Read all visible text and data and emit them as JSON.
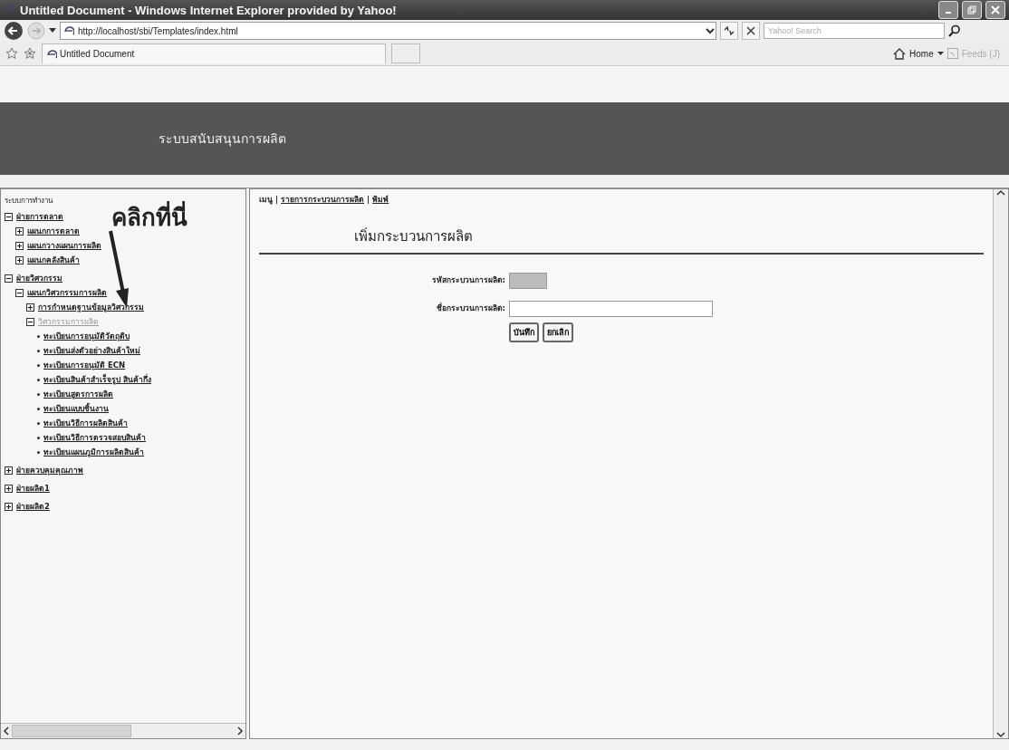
{
  "window": {
    "title": "Untitled Document - Windows Internet Explorer provided by Yahoo!"
  },
  "address_bar": {
    "url": "http://localhost/sbi/Templates/index.html"
  },
  "search": {
    "placeholder": "Yahoo! Search"
  },
  "tabs": [
    {
      "label": "Untitled Document",
      "selected": true
    }
  ],
  "command_bar": {
    "home": "Home",
    "feeds": "Feeds (J)"
  },
  "banner": {
    "title": "ระบบสนับสนุนการผลิต"
  },
  "sidebar": {
    "heading": "ระบบการทำงาน",
    "annotation": "คลิกที่นี่",
    "tree": [
      {
        "label": "ฝ่ายการตลาด",
        "kind": "toggle",
        "expanded": true,
        "children": [
          {
            "label": "แผนกการตลาด",
            "kind": "toggle",
            "expanded": false
          },
          {
            "label": "แผนกวางแผนการผลิต",
            "kind": "toggle",
            "expanded": false
          },
          {
            "label": "แผนกคลังสินค้า",
            "kind": "toggle",
            "expanded": false
          }
        ]
      },
      {
        "label": "ฝ่ายวิศวกรรม",
        "kind": "toggle",
        "expanded": true,
        "children": [
          {
            "label": "แผนกวิศวกรรมการผลิต",
            "kind": "toggle",
            "expanded": true,
            "children": [
              {
                "label": "การกำหนดฐานข้อมูลวิศวกรรม",
                "kind": "toggle",
                "expanded": false,
                "active": false
              },
              {
                "label": "วิศวกรรมการผลิต",
                "kind": "toggle",
                "expanded": true,
                "active": true,
                "children": [
                  {
                    "label": "ทะเบียนการอนุมัติวัตถุดิบ",
                    "kind": "bullet"
                  },
                  {
                    "label": "ทะเบียนส่งตัวอย่างสินค้าใหม่",
                    "kind": "bullet"
                  },
                  {
                    "label": "ทะเบียนการอนุมัติ ECN",
                    "kind": "bullet"
                  },
                  {
                    "label": "ทะเบียนสินค้าสำเร็จรูป สินค้ากึ่ง",
                    "kind": "bullet"
                  },
                  {
                    "label": "ทะเบียนสูตรการผลิต",
                    "kind": "bullet"
                  },
                  {
                    "label": "ทะเบียนแบบชิ้นงาน",
                    "kind": "bullet"
                  },
                  {
                    "label": "ทะเบียนวิธีการผลิตสินค้า",
                    "kind": "bullet"
                  },
                  {
                    "label": "ทะเบียนวิธีการตรวจสอบสินค้า",
                    "kind": "bullet"
                  },
                  {
                    "label": "ทะเบียนแผนภูมิการผลิตสินค้า",
                    "kind": "bullet"
                  }
                ]
              }
            ]
          }
        ]
      },
      {
        "label": "ฝ่ายควบคุมคุณภาพ",
        "kind": "toggle",
        "expanded": false
      },
      {
        "label": "ฝ่ายผลิต1",
        "kind": "toggle",
        "expanded": false
      },
      {
        "label": "ฝ่ายผลิต2",
        "kind": "toggle",
        "expanded": false
      }
    ]
  },
  "content": {
    "menu_label": "เมนู",
    "separator": "|",
    "menu_links": [
      "รายการกระบวนการผลิต",
      "พิมพ์"
    ],
    "heading": "เพิ่มกระบวนการผลิต",
    "fields": [
      {
        "label": "รหัสกระบวนการผลิต:",
        "disabled": true
      },
      {
        "label": "ชื่อกระบวนการผลิต:",
        "disabled": false
      }
    ],
    "buttons": [
      "บันทึก",
      "ยกเลิก"
    ]
  }
}
